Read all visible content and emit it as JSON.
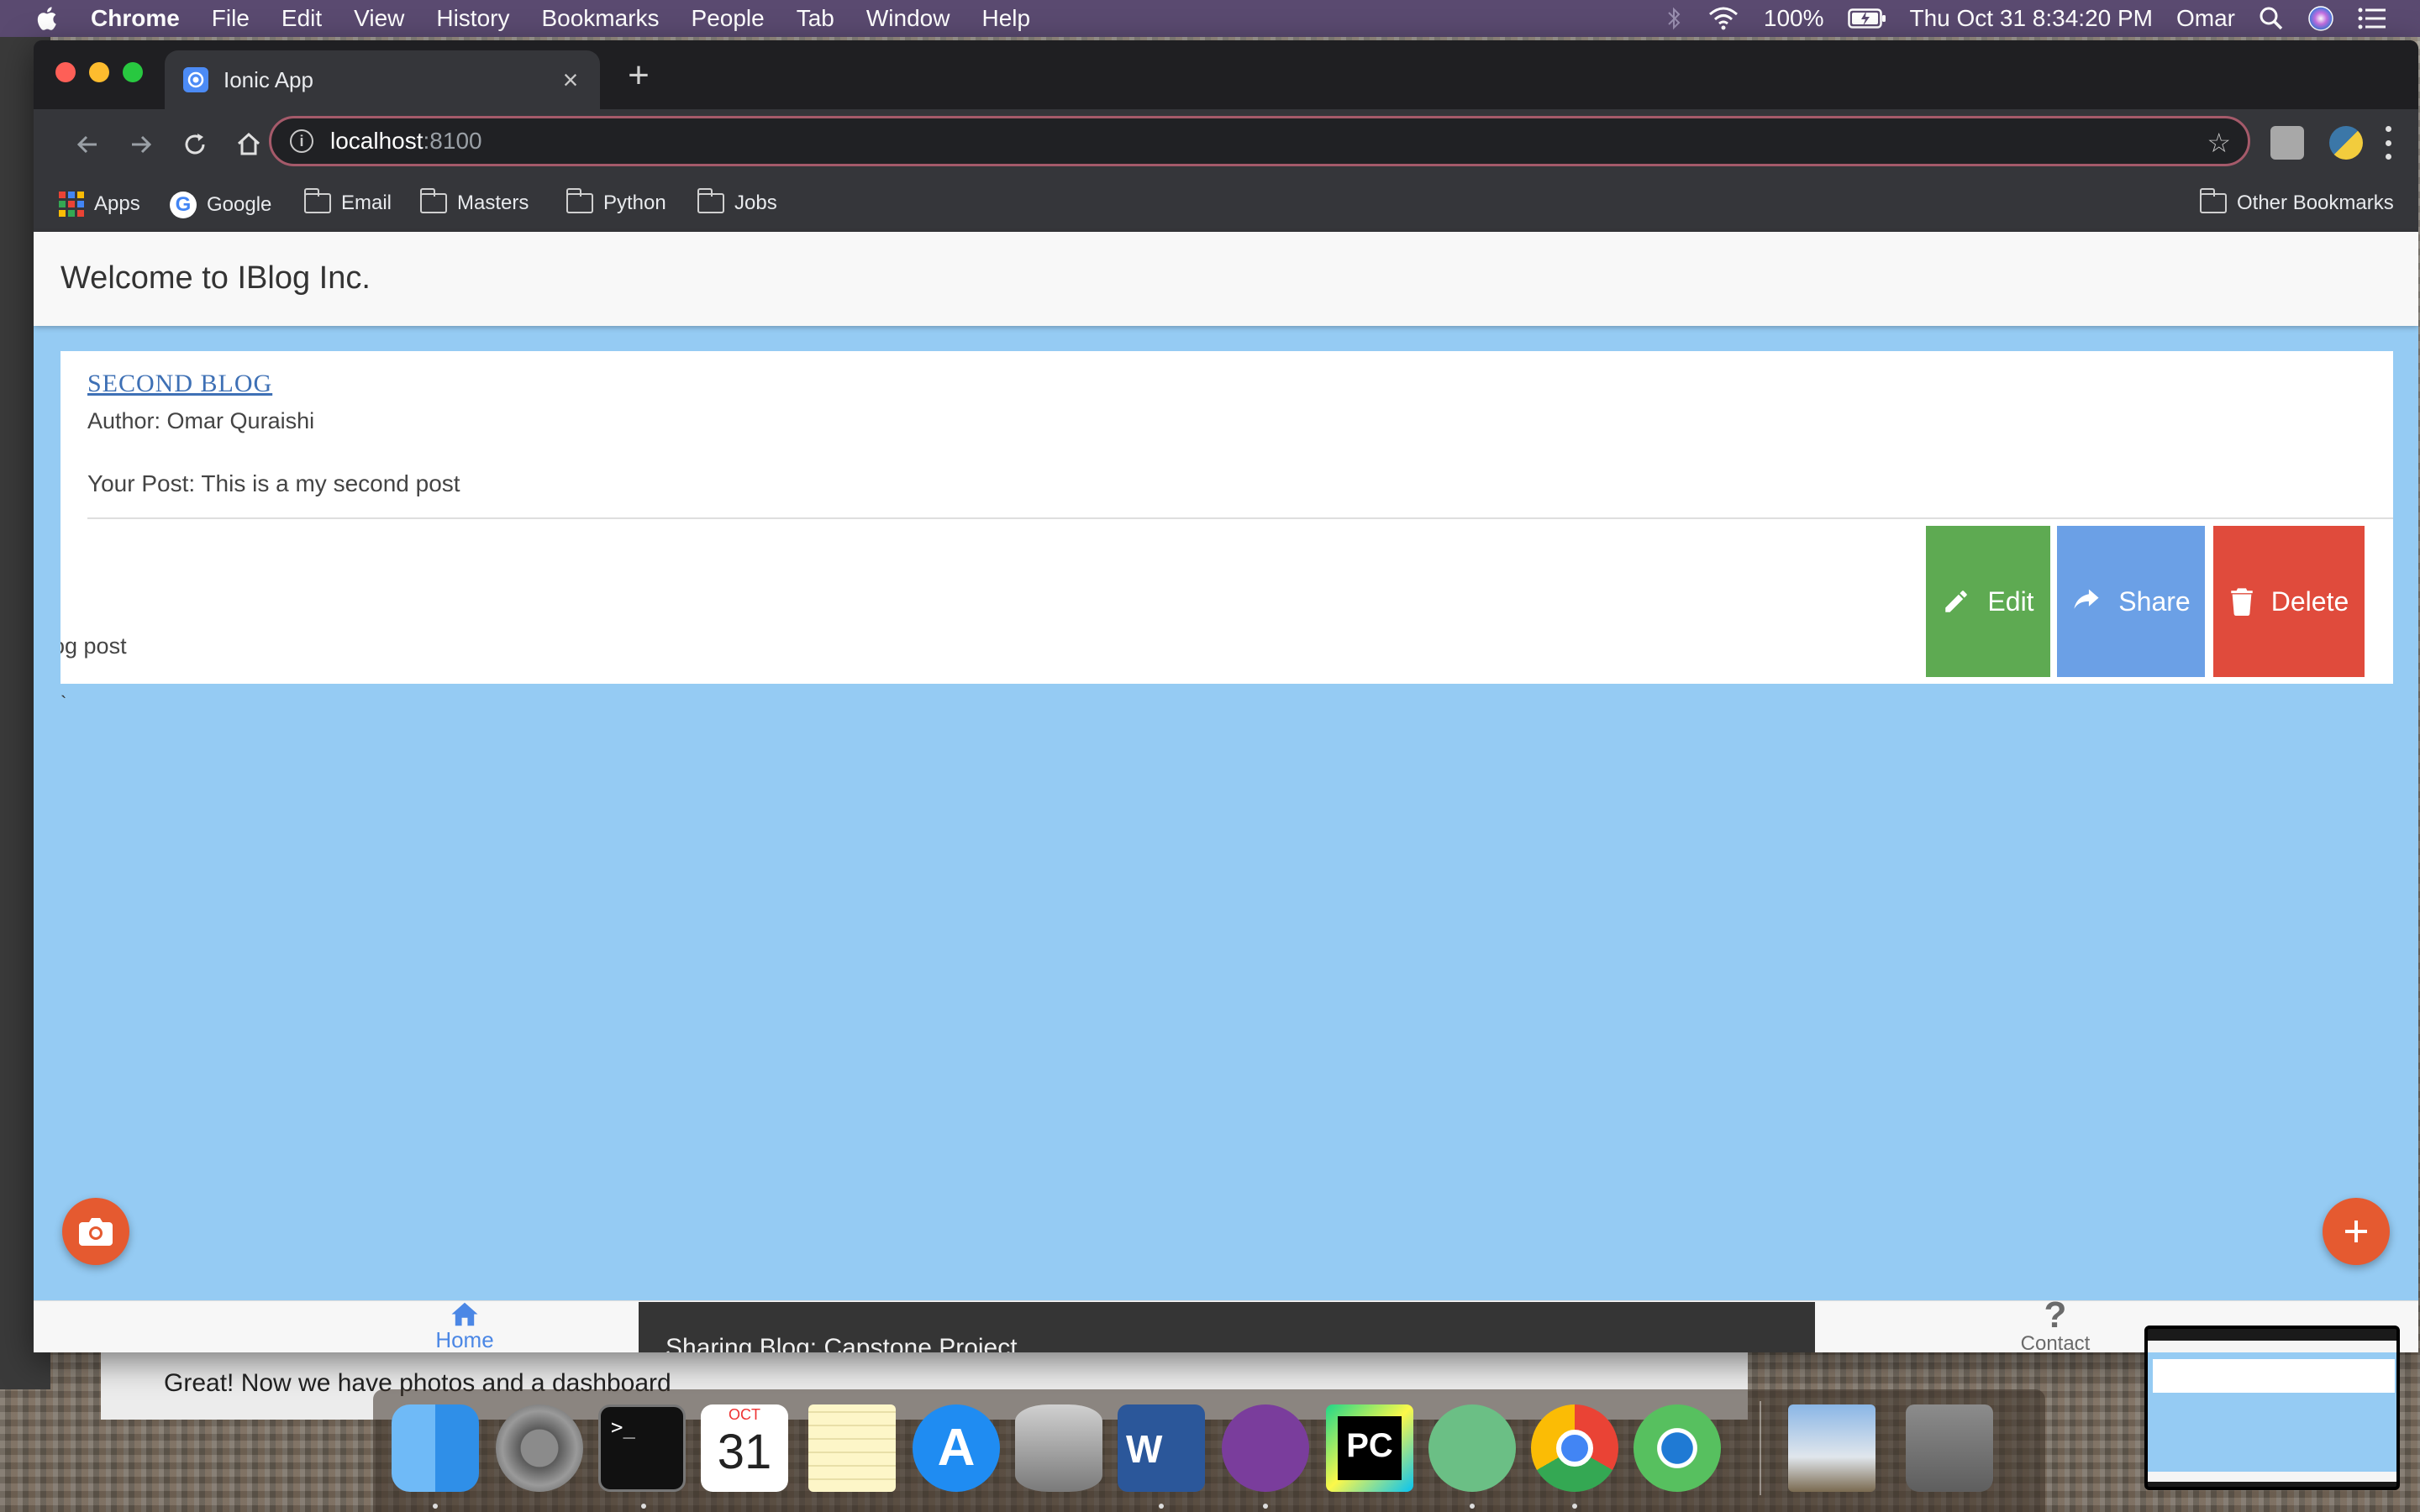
{
  "menubar": {
    "app_name": "Chrome",
    "menus": [
      "File",
      "Edit",
      "View",
      "History",
      "Bookmarks",
      "People",
      "Tab",
      "Window",
      "Help"
    ],
    "battery": "100%",
    "datetime": "Thu Oct 31  8:34:20 PM",
    "user": "Omar"
  },
  "browser": {
    "tab_title": "Ionic App",
    "url_host": "localhost",
    "url_port": ":8100",
    "bookmarks": [
      "Apps",
      "Google",
      "Email",
      "Masters",
      "Python",
      "Jobs"
    ],
    "other_bookmarks": "Other Bookmarks"
  },
  "app": {
    "header_title": "Welcome to IBlog Inc.",
    "card": {
      "blog_title": "SECOND BLOG",
      "author": "Author: Omar Quraishi",
      "post": "Your Post: This is a my second post",
      "partial_text": "og post",
      "stray_char": "`"
    },
    "actions": {
      "edit": "Edit",
      "share": "Share",
      "delete": "Delete"
    },
    "tabs": {
      "home": "Home",
      "contact": "Contact"
    },
    "toast": "Sharing Blog: Capstone Project"
  },
  "dock": {
    "calendar_month": "OCT",
    "calendar_day": "31"
  },
  "behind_window_text": "Great! Now we have photos and a dashboard"
}
